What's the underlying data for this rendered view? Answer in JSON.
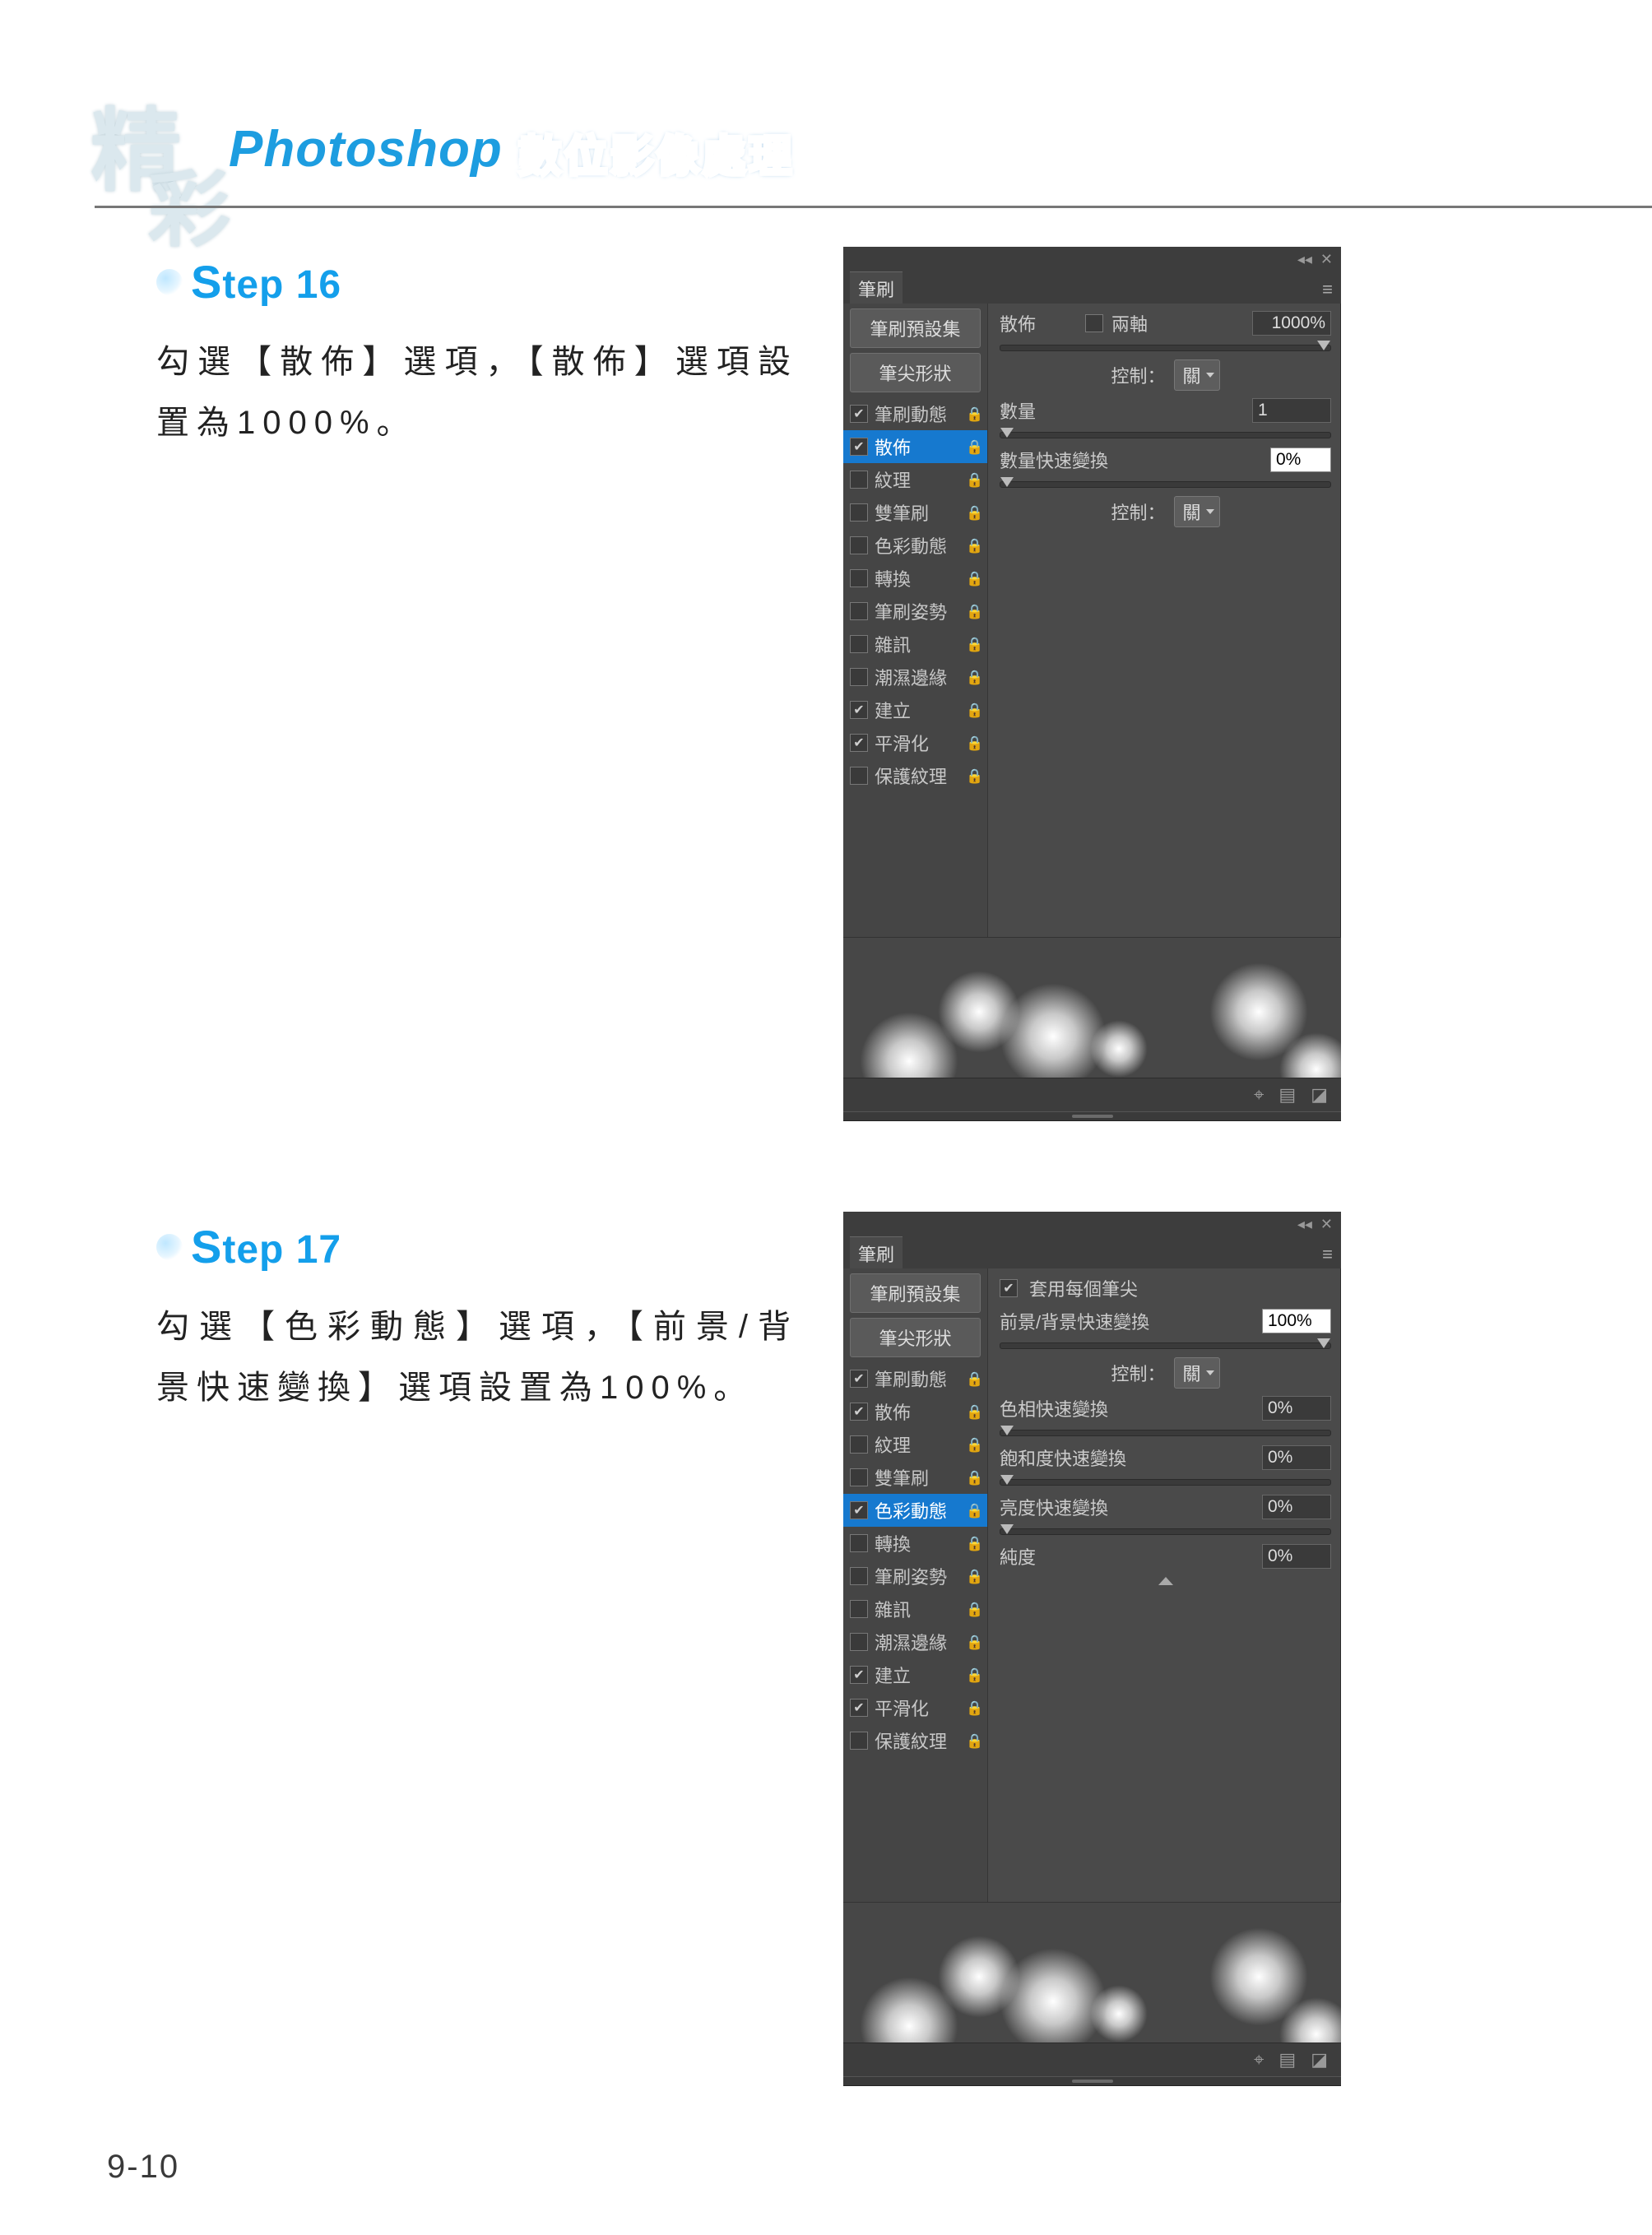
{
  "brand": {
    "cn1": "精",
    "cn2": "彩",
    "ps": "Photoshop",
    "sub": "數位影像處理"
  },
  "page_number": "9-10",
  "step16": {
    "label": "tep 16",
    "cap": "S",
    "body": "勾選【散佈】選項，【散佈】選項設置為1000%。",
    "panel": {
      "tab": "筆刷",
      "presets": "筆刷預設集",
      "tipShape": "筆尖形狀",
      "items": [
        {
          "label": "筆刷動態",
          "checked": true,
          "lock": true
        },
        {
          "label": "散佈",
          "checked": true,
          "lock": true,
          "selected": true
        },
        {
          "label": "紋理",
          "checked": false,
          "lock": true
        },
        {
          "label": "雙筆刷",
          "checked": false,
          "lock": true
        },
        {
          "label": "色彩動態",
          "checked": false,
          "lock": true
        },
        {
          "label": "轉換",
          "checked": false,
          "lock": true
        },
        {
          "label": "筆刷姿勢",
          "checked": false,
          "lock": true
        },
        {
          "label": "雜訊",
          "checked": false,
          "lock": true
        },
        {
          "label": "潮濕邊緣",
          "checked": false,
          "lock": true
        },
        {
          "label": "建立",
          "checked": true,
          "lock": true
        },
        {
          "label": "平滑化",
          "checked": true,
          "lock": true
        },
        {
          "label": "保護紋理",
          "checked": false,
          "lock": true
        }
      ],
      "scatter_label": "散佈",
      "both_axes": "兩軸",
      "scatter_value": "1000%",
      "control": "控制：",
      "control_value": "關",
      "count": "數量",
      "count_value": "1",
      "count_jitter": "數量快速變換",
      "count_jitter_value": "0%",
      "control2": "控制：",
      "control2_value": "關"
    }
  },
  "step17": {
    "label": "tep 17",
    "cap": "S",
    "body": "勾選【色彩動態】選項，【前景/背景快速變換】選項設置為100%。",
    "panel": {
      "tab": "筆刷",
      "presets": "筆刷預設集",
      "tipShape": "筆尖形狀",
      "items": [
        {
          "label": "筆刷動態",
          "checked": true,
          "lock": true
        },
        {
          "label": "散佈",
          "checked": true,
          "lock": true
        },
        {
          "label": "紋理",
          "checked": false,
          "lock": true
        },
        {
          "label": "雙筆刷",
          "checked": false,
          "lock": true
        },
        {
          "label": "色彩動態",
          "checked": true,
          "lock": true,
          "selected": true
        },
        {
          "label": "轉換",
          "checked": false,
          "lock": true
        },
        {
          "label": "筆刷姿勢",
          "checked": false,
          "lock": true
        },
        {
          "label": "雜訊",
          "checked": false,
          "lock": true
        },
        {
          "label": "潮濕邊緣",
          "checked": false,
          "lock": true
        },
        {
          "label": "建立",
          "checked": true,
          "lock": true
        },
        {
          "label": "平滑化",
          "checked": true,
          "lock": true
        },
        {
          "label": "保護紋理",
          "checked": false,
          "lock": true
        }
      ],
      "apply_per_tip": "套用每個筆尖",
      "fgbg": "前景/背景快速變換",
      "fgbg_value": "100%",
      "control": "控制：",
      "control_value": "關",
      "hue": "色相快速變換",
      "hue_value": "0%",
      "sat": "飽和度快速變換",
      "sat_value": "0%",
      "bri": "亮度快速變換",
      "bri_value": "0%",
      "pur": "純度",
      "pur_value": "0%"
    }
  },
  "icons": {
    "collapse": "◂◂",
    "close": "✕",
    "menu": "≡",
    "toggle": "⌖",
    "doc": "▤",
    "page": "◪",
    "lock": "🔒",
    "check": "✔"
  }
}
